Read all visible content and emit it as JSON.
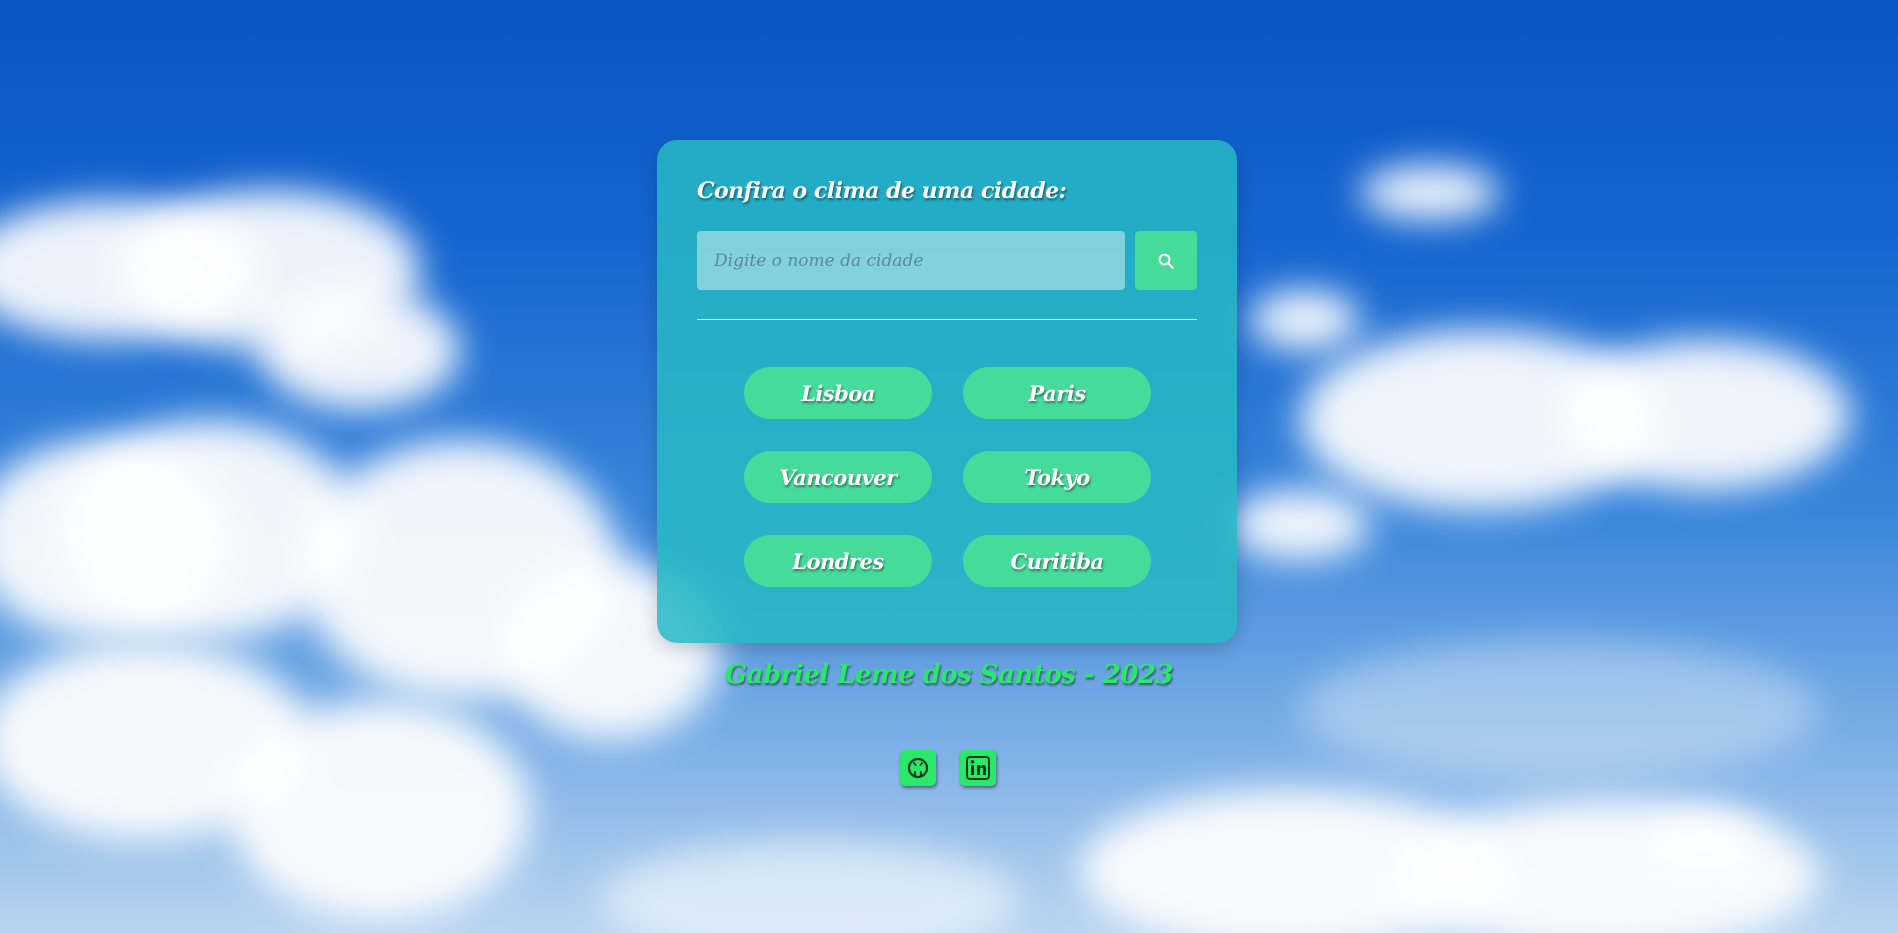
{
  "card": {
    "title": "Confira o clima de uma cidade:",
    "search": {
      "placeholder": "Digite o nome da cidade",
      "value": "",
      "button_icon": "search-icon"
    }
  },
  "cities": [
    "Lisboa",
    "Paris",
    "Vancouver",
    "Tokyo",
    "Londres",
    "Curitiba"
  ],
  "footer": {
    "credit": "Gabriel Leme dos Santos - 2023",
    "social": [
      "github-icon",
      "linkedin-icon"
    ]
  },
  "colors": {
    "card_bg": "#26b8c4",
    "accent_green": "#45dc9b",
    "footer_green": "#2be86a",
    "text_white": "#ffffff"
  }
}
